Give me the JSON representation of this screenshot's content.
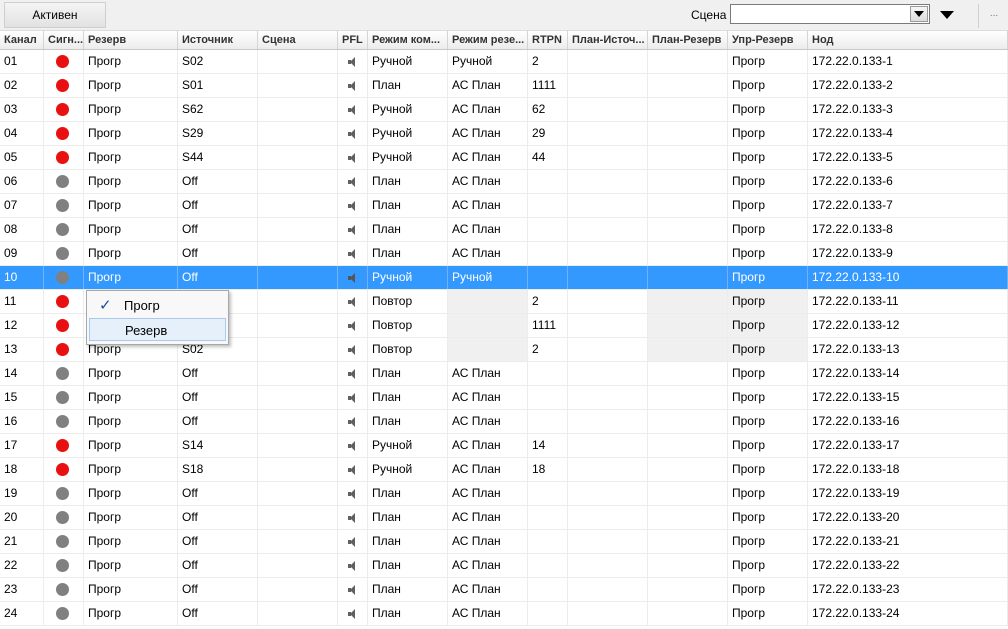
{
  "toolbar": {
    "active_label": "Активен",
    "scene_label": "Сцена",
    "scene_value": "",
    "more_label": "..."
  },
  "columns": [
    "Канал",
    "Сигн...",
    "Резерв",
    "Источник",
    "Сцена",
    "PFL",
    "Режим ком...",
    "Режим резе...",
    "RTPN",
    "План-Источ...",
    "План-Резерв",
    "Упр-Резерв",
    "Нод"
  ],
  "colors": {
    "red": "#e81010",
    "gray": "#808080",
    "selection": "#3399ff"
  },
  "rows": [
    {
      "ch": "01",
      "sig": "red",
      "rezerv": "Прогр",
      "src": "S02",
      "scene": "",
      "mode": "Ручной",
      "rmode": "Ручной",
      "rtpn": "2",
      "ps": "",
      "pr": "",
      "ur": "Прогр",
      "node": "172.22.0.133-1"
    },
    {
      "ch": "02",
      "sig": "red",
      "rezerv": "Прогр",
      "src": "S01",
      "scene": "",
      "mode": "План",
      "rmode": "АС План",
      "rtpn": "1111",
      "ps": "",
      "pr": "",
      "ur": "Прогр",
      "node": "172.22.0.133-2"
    },
    {
      "ch": "03",
      "sig": "red",
      "rezerv": "Прогр",
      "src": "S62",
      "scene": "",
      "mode": "Ручной",
      "rmode": "АС План",
      "rtpn": "62",
      "ps": "",
      "pr": "",
      "ur": "Прогр",
      "node": "172.22.0.133-3"
    },
    {
      "ch": "04",
      "sig": "red",
      "rezerv": "Прогр",
      "src": "S29",
      "scene": "",
      "mode": "Ручной",
      "rmode": "АС План",
      "rtpn": "29",
      "ps": "",
      "pr": "",
      "ur": "Прогр",
      "node": "172.22.0.133-4"
    },
    {
      "ch": "05",
      "sig": "red",
      "rezerv": "Прогр",
      "src": "S44",
      "scene": "",
      "mode": "Ручной",
      "rmode": "АС План",
      "rtpn": "44",
      "ps": "",
      "pr": "",
      "ur": "Прогр",
      "node": "172.22.0.133-5"
    },
    {
      "ch": "06",
      "sig": "gray",
      "rezerv": "Прогр",
      "src": "Off",
      "scene": "",
      "mode": "План",
      "rmode": "АС План",
      "rtpn": "",
      "ps": "",
      "pr": "",
      "ur": "Прогр",
      "node": "172.22.0.133-6"
    },
    {
      "ch": "07",
      "sig": "gray",
      "rezerv": "Прогр",
      "src": "Off",
      "scene": "",
      "mode": "План",
      "rmode": "АС План",
      "rtpn": "",
      "ps": "",
      "pr": "",
      "ur": "Прогр",
      "node": "172.22.0.133-7"
    },
    {
      "ch": "08",
      "sig": "gray",
      "rezerv": "Прогр",
      "src": "Off",
      "scene": "",
      "mode": "План",
      "rmode": "АС План",
      "rtpn": "",
      "ps": "",
      "pr": "",
      "ur": "Прогр",
      "node": "172.22.0.133-8"
    },
    {
      "ch": "09",
      "sig": "gray",
      "rezerv": "Прогр",
      "src": "Off",
      "scene": "",
      "mode": "План",
      "rmode": "АС План",
      "rtpn": "",
      "ps": "",
      "pr": "",
      "ur": "Прогр",
      "node": "172.22.0.133-9"
    },
    {
      "ch": "10",
      "sig": "gray",
      "rezerv": "Прогр",
      "src": "Off",
      "scene": "",
      "mode": "Ручной",
      "rmode": "Ручной",
      "rtpn": "",
      "ps": "",
      "pr": "",
      "ur": "Прогр",
      "node": "172.22.0.133-10",
      "selected": true
    },
    {
      "ch": "11",
      "sig": "red",
      "rezerv": "",
      "src": "",
      "scene": "",
      "mode": "Повтор",
      "rmode": "",
      "rtpn": "2",
      "ps": "",
      "pr": "",
      "ur": "Прогр",
      "node": "172.22.0.133-11",
      "shaded": true
    },
    {
      "ch": "12",
      "sig": "red",
      "rezerv": "",
      "src": "",
      "scene": "",
      "mode": "Повтор",
      "rmode": "",
      "rtpn": "1111",
      "ps": "",
      "pr": "",
      "ur": "Прогр",
      "node": "172.22.0.133-12",
      "shaded": true
    },
    {
      "ch": "13",
      "sig": "red",
      "rezerv": "Прогр",
      "src": "S02",
      "scene": "",
      "mode": "Повтор",
      "rmode": "",
      "rtpn": "2",
      "ps": "",
      "pr": "",
      "ur": "Прогр",
      "node": "172.22.0.133-13",
      "shaded": true
    },
    {
      "ch": "14",
      "sig": "gray",
      "rezerv": "Прогр",
      "src": "Off",
      "scene": "",
      "mode": "План",
      "rmode": "АС План",
      "rtpn": "",
      "ps": "",
      "pr": "",
      "ur": "Прогр",
      "node": "172.22.0.133-14"
    },
    {
      "ch": "15",
      "sig": "gray",
      "rezerv": "Прогр",
      "src": "Off",
      "scene": "",
      "mode": "План",
      "rmode": "АС План",
      "rtpn": "",
      "ps": "",
      "pr": "",
      "ur": "Прогр",
      "node": "172.22.0.133-15"
    },
    {
      "ch": "16",
      "sig": "gray",
      "rezerv": "Прогр",
      "src": "Off",
      "scene": "",
      "mode": "План",
      "rmode": "АС План",
      "rtpn": "",
      "ps": "",
      "pr": "",
      "ur": "Прогр",
      "node": "172.22.0.133-16"
    },
    {
      "ch": "17",
      "sig": "red",
      "rezerv": "Прогр",
      "src": "S14",
      "scene": "",
      "mode": "Ручной",
      "rmode": "АС План",
      "rtpn": "14",
      "ps": "",
      "pr": "",
      "ur": "Прогр",
      "node": "172.22.0.133-17"
    },
    {
      "ch": "18",
      "sig": "red",
      "rezerv": "Прогр",
      "src": "S18",
      "scene": "",
      "mode": "Ручной",
      "rmode": "АС План",
      "rtpn": "18",
      "ps": "",
      "pr": "",
      "ur": "Прогр",
      "node": "172.22.0.133-18"
    },
    {
      "ch": "19",
      "sig": "gray",
      "rezerv": "Прогр",
      "src": "Off",
      "scene": "",
      "mode": "План",
      "rmode": "АС План",
      "rtpn": "",
      "ps": "",
      "pr": "",
      "ur": "Прогр",
      "node": "172.22.0.133-19"
    },
    {
      "ch": "20",
      "sig": "gray",
      "rezerv": "Прогр",
      "src": "Off",
      "scene": "",
      "mode": "План",
      "rmode": "АС План",
      "rtpn": "",
      "ps": "",
      "pr": "",
      "ur": "Прогр",
      "node": "172.22.0.133-20"
    },
    {
      "ch": "21",
      "sig": "gray",
      "rezerv": "Прогр",
      "src": "Off",
      "scene": "",
      "mode": "План",
      "rmode": "АС План",
      "rtpn": "",
      "ps": "",
      "pr": "",
      "ur": "Прогр",
      "node": "172.22.0.133-21"
    },
    {
      "ch": "22",
      "sig": "gray",
      "rezerv": "Прогр",
      "src": "Off",
      "scene": "",
      "mode": "План",
      "rmode": "АС План",
      "rtpn": "",
      "ps": "",
      "pr": "",
      "ur": "Прогр",
      "node": "172.22.0.133-22"
    },
    {
      "ch": "23",
      "sig": "gray",
      "rezerv": "Прогр",
      "src": "Off",
      "scene": "",
      "mode": "План",
      "rmode": "АС План",
      "rtpn": "",
      "ps": "",
      "pr": "",
      "ur": "Прогр",
      "node": "172.22.0.133-23"
    },
    {
      "ch": "24",
      "sig": "gray",
      "rezerv": "Прогр",
      "src": "Off",
      "scene": "",
      "mode": "План",
      "rmode": "АС План",
      "rtpn": "",
      "ps": "",
      "pr": "",
      "ur": "Прогр",
      "node": "172.22.0.133-24"
    }
  ],
  "context_menu": {
    "items": [
      {
        "label": "Прогр",
        "checked": true
      },
      {
        "label": "Резерв",
        "checked": false
      }
    ]
  }
}
